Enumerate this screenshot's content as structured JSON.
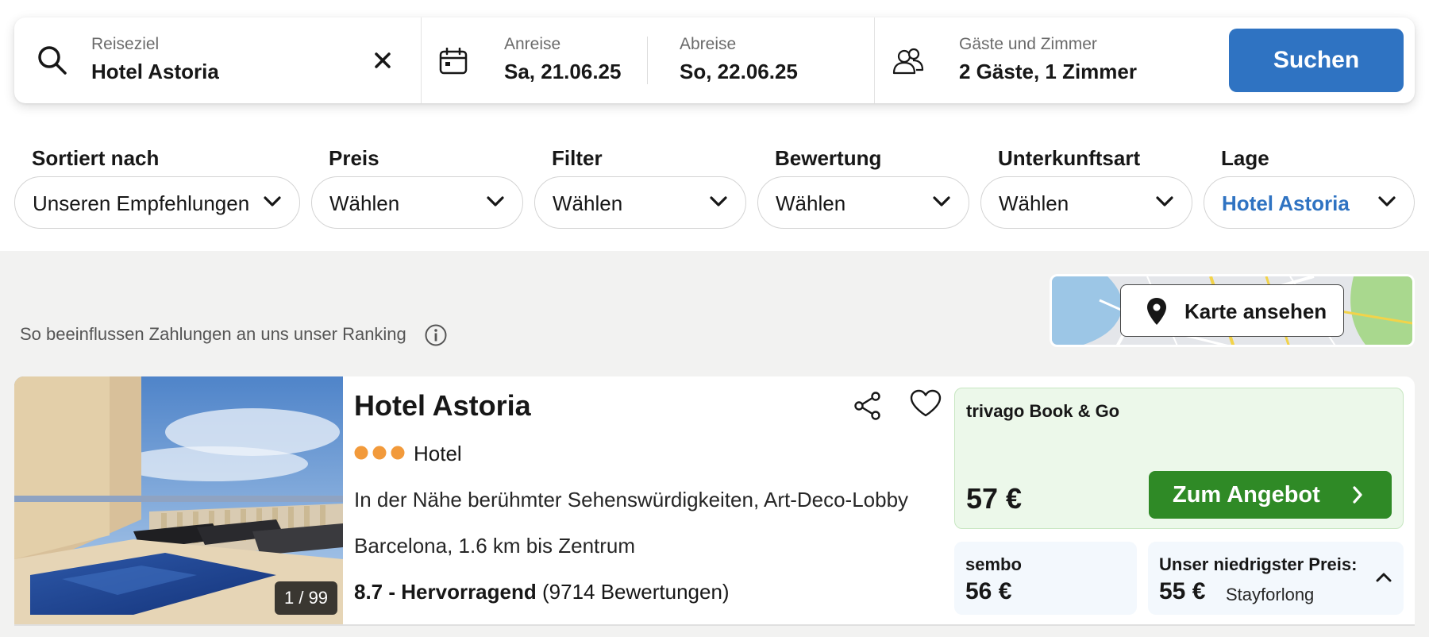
{
  "search": {
    "destination_label": "Reiseziel",
    "destination_value": "Hotel Astoria",
    "checkin_label": "Anreise",
    "checkin_value": "Sa, 21.06.25",
    "checkout_label": "Abreise",
    "checkout_value": "So, 22.06.25",
    "guests_label": "Gäste und Zimmer",
    "guests_value": "2 Gäste, 1 Zimmer",
    "search_button": "Suchen"
  },
  "filters": [
    {
      "label": "Sortiert nach",
      "value": "Unseren Empfehlungen"
    },
    {
      "label": "Preis",
      "value": "Wählen"
    },
    {
      "label": "Filter",
      "value": "Wählen"
    },
    {
      "label": "Bewertung",
      "value": "Wählen"
    },
    {
      "label": "Unterkunftsart",
      "value": "Wählen"
    },
    {
      "label": "Lage",
      "value": "Hotel Astoria"
    }
  ],
  "ranking_text": "So beeinflussen Zahlungen an uns unser Ranking",
  "map_button": "Karte ansehen",
  "hotel": {
    "photo_counter": "1 / 99",
    "name": "Hotel Astoria",
    "stars": 3,
    "type": "Hotel",
    "description": "In der Nähe berühmter Sehenswürdigkeiten, Art-Deco-Lobby",
    "location": "Barcelona, 1.6 km bis Zentrum",
    "rating_bold": "8.7 - Hervorragend",
    "rating_count": "(9714 Bewertungen)",
    "deal": {
      "provider": "trivago Book & Go",
      "price": "57 €",
      "button": "Zum Angebot"
    },
    "alt_offer": {
      "provider": "sembo",
      "price": "56 €"
    },
    "lowest_offer": {
      "label": "Unser niedrigster Preis:",
      "price": "55 €",
      "provider": "Stayforlong"
    }
  },
  "colors": {
    "accent_blue": "#2f73c2",
    "deal_green": "#2f8a26",
    "star_orange": "#f29a3b"
  }
}
